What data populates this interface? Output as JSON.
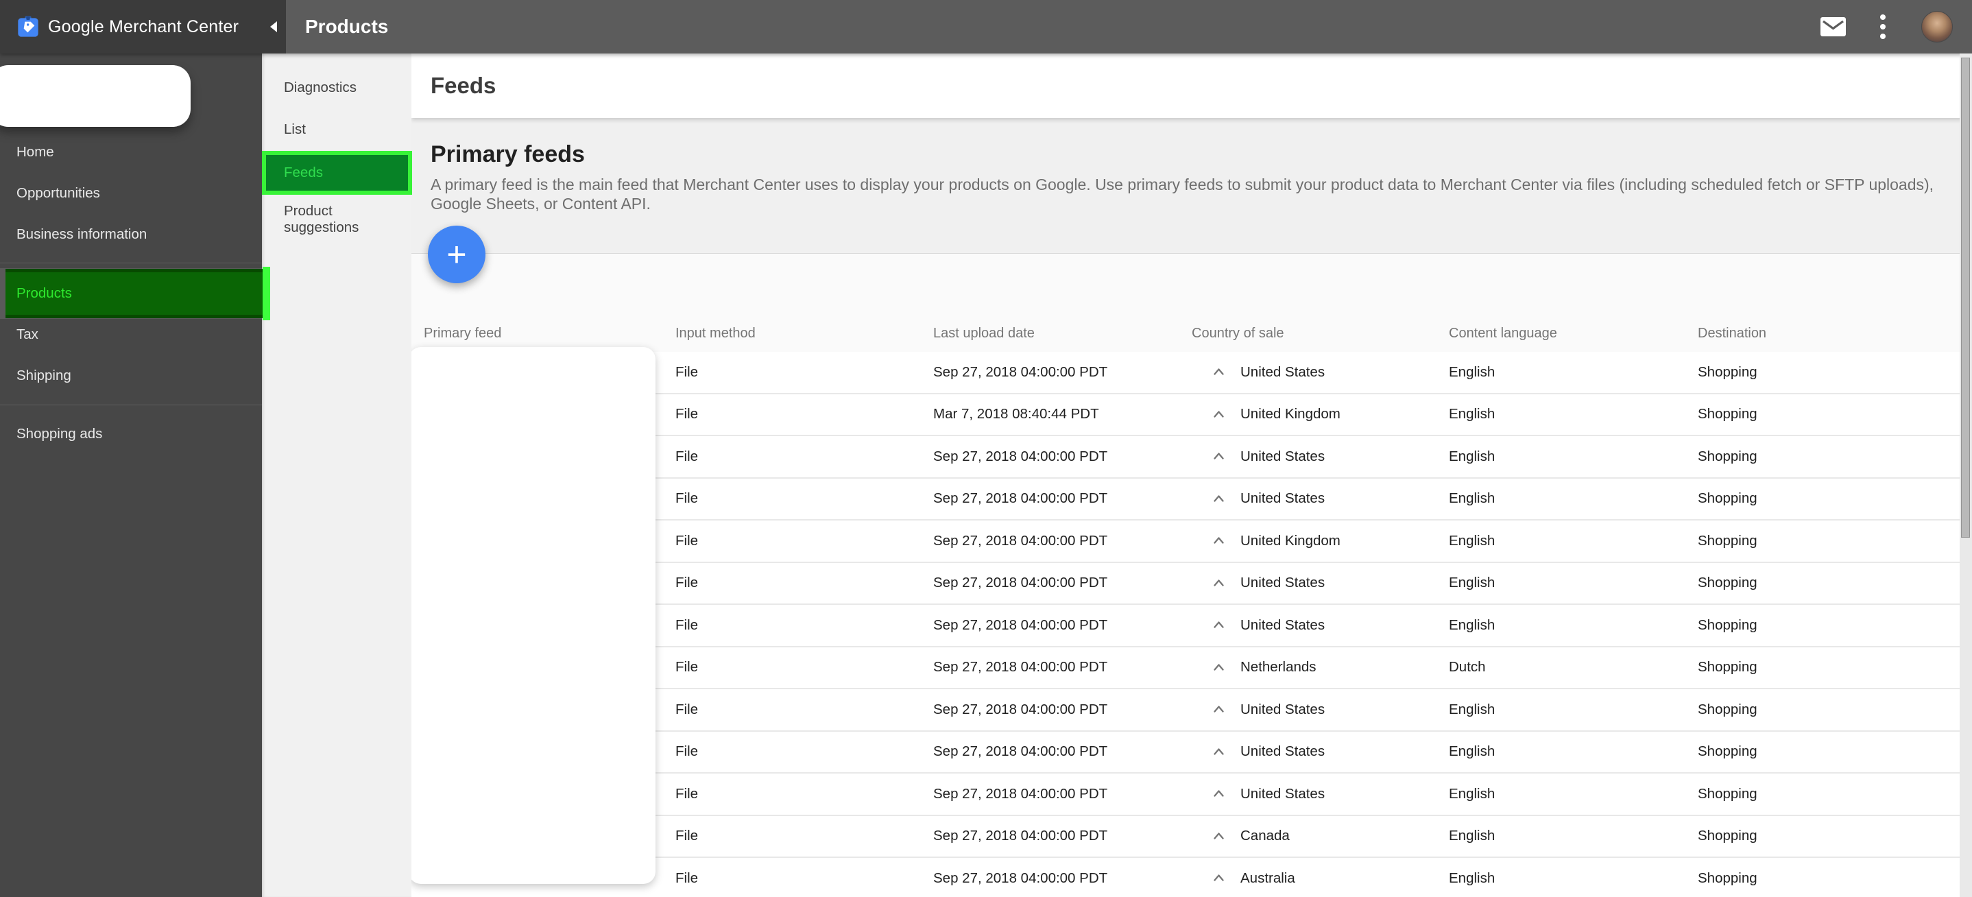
{
  "topbar": {
    "brand": "Google Merchant Center",
    "page_title": "Products"
  },
  "sidebar": {
    "items": [
      {
        "label": "Home"
      },
      {
        "label": "Opportunities"
      },
      {
        "label": "Business information"
      },
      {
        "label": "Products",
        "selected": true,
        "highlighted": true
      },
      {
        "label": "Tax"
      },
      {
        "label": "Shipping"
      },
      {
        "label": "Shopping ads"
      }
    ]
  },
  "subnav": {
    "items": [
      {
        "label": "Diagnostics"
      },
      {
        "label": "List"
      },
      {
        "label": "Feeds",
        "selected": true,
        "highlighted": true
      },
      {
        "label": "Product suggestions"
      }
    ]
  },
  "main": {
    "title": "Feeds",
    "section": {
      "heading": "Primary feeds",
      "description": "A primary feed is the main feed that Merchant Center uses to display your products on Google. Use primary feeds to submit your product data to Merchant Center via files (including scheduled fetch or SFTP uploads), Google Sheets, or Content API.",
      "add_button_glyph": "+"
    },
    "table": {
      "columns": [
        "Primary feed",
        "Input method",
        "Last upload date",
        "Country of sale",
        "Content language",
        "Destination"
      ],
      "rows": [
        {
          "input_method": "File",
          "last_upload": "Sep 27, 2018 04:00:00 PDT",
          "country": "United States",
          "language": "English",
          "destination": "Shopping"
        },
        {
          "input_method": "File",
          "last_upload": "Mar 7, 2018 08:40:44 PDT",
          "country": "United Kingdom",
          "language": "English",
          "destination": "Shopping"
        },
        {
          "input_method": "File",
          "last_upload": "Sep 27, 2018 04:00:00 PDT",
          "country": "United States",
          "language": "English",
          "destination": "Shopping"
        },
        {
          "input_method": "File",
          "last_upload": "Sep 27, 2018 04:00:00 PDT",
          "country": "United States",
          "language": "English",
          "destination": "Shopping"
        },
        {
          "input_method": "File",
          "last_upload": "Sep 27, 2018 04:00:00 PDT",
          "country": "United Kingdom",
          "language": "English",
          "destination": "Shopping"
        },
        {
          "input_method": "File",
          "last_upload": "Sep 27, 2018 04:00:00 PDT",
          "country": "United States",
          "language": "English",
          "destination": "Shopping"
        },
        {
          "input_method": "File",
          "last_upload": "Sep 27, 2018 04:00:00 PDT",
          "country": "United States",
          "language": "English",
          "destination": "Shopping"
        },
        {
          "input_method": "File",
          "last_upload": "Sep 27, 2018 04:00:00 PDT",
          "country": "Netherlands",
          "language": "Dutch",
          "destination": "Shopping"
        },
        {
          "input_method": "File",
          "last_upload": "Sep 27, 2018 04:00:00 PDT",
          "country": "United States",
          "language": "English",
          "destination": "Shopping"
        },
        {
          "input_method": "File",
          "last_upload": "Sep 27, 2018 04:00:00 PDT",
          "country": "United States",
          "language": "English",
          "destination": "Shopping"
        },
        {
          "input_method": "File",
          "last_upload": "Sep 27, 2018 04:00:00 PDT",
          "country": "United States",
          "language": "English",
          "destination": "Shopping"
        },
        {
          "input_method": "File",
          "last_upload": "Sep 27, 2018 04:00:00 PDT",
          "country": "Canada",
          "language": "English",
          "destination": "Shopping"
        },
        {
          "input_method": "File",
          "last_upload": "Sep 27, 2018 04:00:00 PDT",
          "country": "Australia",
          "language": "English",
          "destination": "Shopping"
        }
      ]
    }
  },
  "icons": {
    "logo": "merchant-center-logo",
    "mail": "mail-icon",
    "more": "kebab-menu-icon",
    "collapse": "collapse-arrow-icon",
    "row_collapse": "chevron-up-icon",
    "add": "plus-icon"
  },
  "colors": {
    "topbar_left_bg": "#3b3b3b",
    "topbar_bg": "#5c5c5c",
    "sidebar_bg": "#474747",
    "subnav_bg": "#f1f1f1",
    "section_bg": "#f0f0f0",
    "accent_blue": "#4285f4",
    "highlight_border_green": "#38f338",
    "highlight_fill_green": "#078226",
    "highlight_text_green": "#30dc4e",
    "products_fill_green": "#0a6505",
    "row_text": "#212121",
    "muted_text": "#757575"
  }
}
